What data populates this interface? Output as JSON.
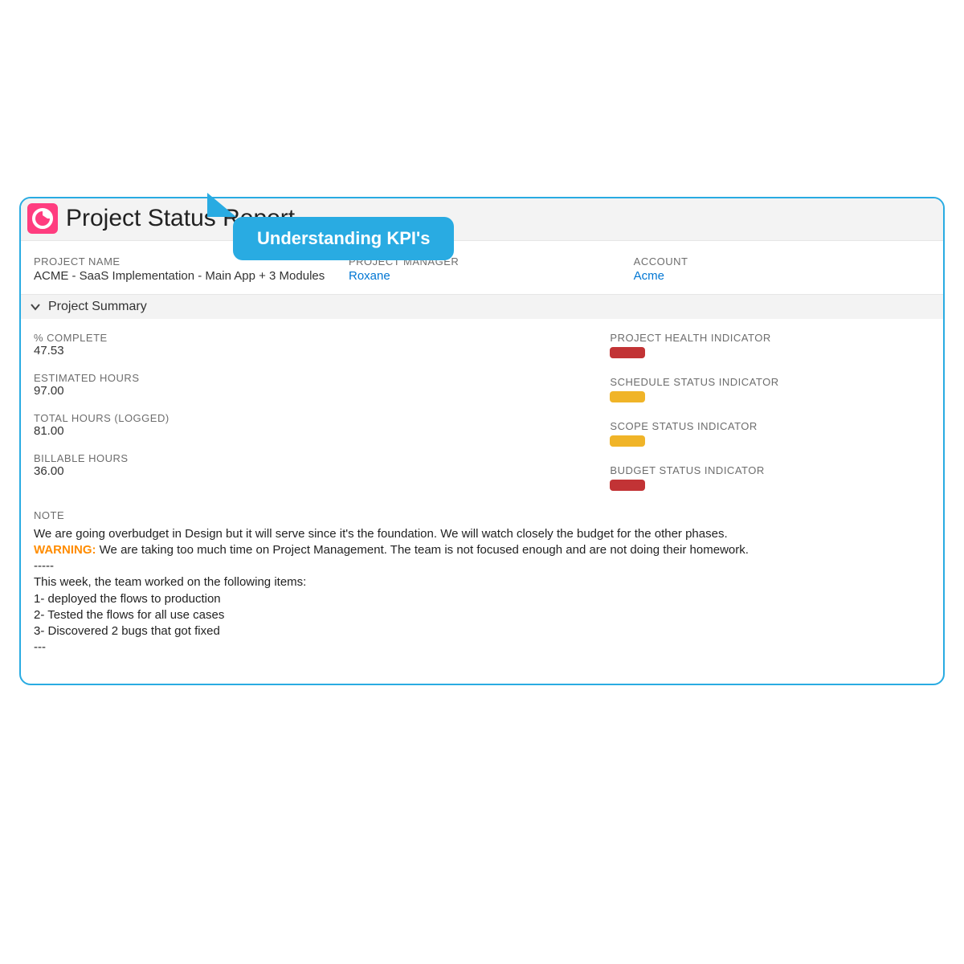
{
  "header": {
    "title": "Project Status Report"
  },
  "project_info": {
    "name_label": "PROJECT NAME",
    "name_value": "ACME - SaaS Implementation - Main App + 3 Modules",
    "manager_label": "PROJECT MANAGER",
    "manager_value": "Roxane",
    "account_label": "ACCOUNT",
    "account_value": "Acme"
  },
  "section": {
    "title": "Project Summary"
  },
  "metrics": {
    "complete_label": "% COMPLETE",
    "complete_value": "47.53",
    "estimated_label": "ESTIMATED HOURS",
    "estimated_value": "97.00",
    "total_label": "TOTAL HOURS (LOGGED)",
    "total_value": "81.00",
    "billable_label": "BILLABLE HOURS",
    "billable_value": "36.00"
  },
  "indicators": {
    "health_label": "PROJECT HEALTH INDICATOR",
    "health_color": "red",
    "schedule_label": "SCHEDULE STATUS INDICATOR",
    "schedule_color": "amber",
    "scope_label": "SCOPE STATUS INDICATOR",
    "scope_color": "amber",
    "budget_label": "BUDGET STATUS INDICATOR",
    "budget_color": "red"
  },
  "note": {
    "label": "NOTE",
    "line1": "We are going overbudget in Design but it will serve since it's the foundation. We will watch closely the budget for the other phases.",
    "warning_prefix": "WARNING:",
    "warning_text": " We are taking too much time on Project Management. The team is not focused enough and are not doing their homework.",
    "divider1": "-----",
    "week_intro": "This week, the team worked on the following items:",
    "item1": "1- deployed the flows to production",
    "item2": "2- Tested the flows for all use cases",
    "item3": "3- Discovered 2 bugs that got fixed",
    "divider2": "---"
  },
  "callout": {
    "text": "Understanding KPI's"
  }
}
